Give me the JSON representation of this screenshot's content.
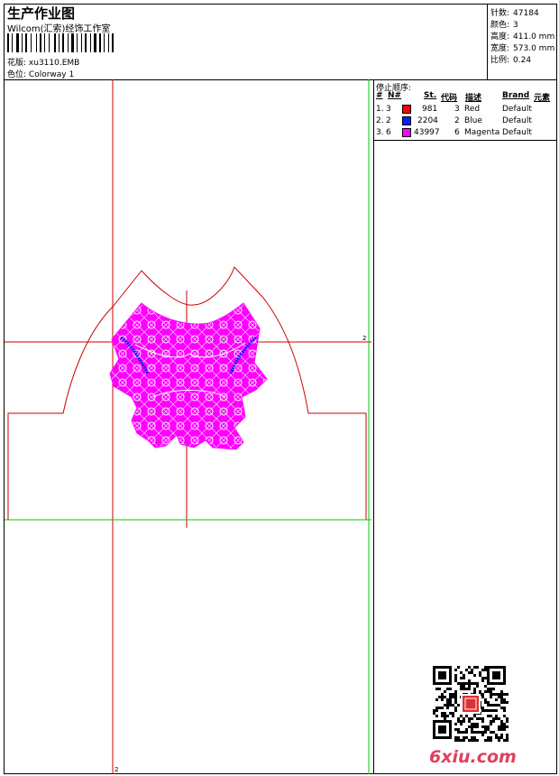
{
  "header": {
    "title": "生产作业图",
    "company": "Wilcom(汇索)经饰工作室",
    "design_label": "花版:",
    "design_value": "xu3110.EMB",
    "colorway_label": "色位:",
    "colorway_value": "Colorway 1"
  },
  "stats": [
    {
      "label": "针数:",
      "value": "47184"
    },
    {
      "label": "颜色:",
      "value": "3"
    },
    {
      "label": "高度:",
      "value": "411.0 mm"
    },
    {
      "label": "宽度:",
      "value": "573.0 mm"
    },
    {
      "label": "比例:",
      "value": "0.24"
    }
  ],
  "stop_sequence": {
    "title": "停止顺序:",
    "headers": {
      "hash": "#",
      "no": "N#",
      "st": "St.",
      "code": "代码",
      "desc": "描述",
      "brand": "Brand",
      "element": "元素"
    },
    "rows": [
      {
        "index": "1.",
        "no": "3",
        "stitches": "981",
        "code": "3",
        "desc": "Red",
        "brand": "Default",
        "color": "#ff0000"
      },
      {
        "index": "2.",
        "no": "2",
        "stitches": "2204",
        "code": "2",
        "desc": "Blue",
        "brand": "Default",
        "color": "#0022ff"
      },
      {
        "index": "3.",
        "no": "6",
        "stitches": "43997",
        "code": "6",
        "desc": "Magenta",
        "brand": "Default",
        "color": "#ff00ff"
      }
    ]
  },
  "canvas": {
    "marker_right": "2",
    "marker_bottom": "2"
  },
  "footer": {
    "site": "6xiu.com"
  },
  "colors": {
    "guide_red": "#cc0000",
    "guide_green": "#00cc00",
    "embroidery": "#ff00ff",
    "border": "#000000"
  }
}
